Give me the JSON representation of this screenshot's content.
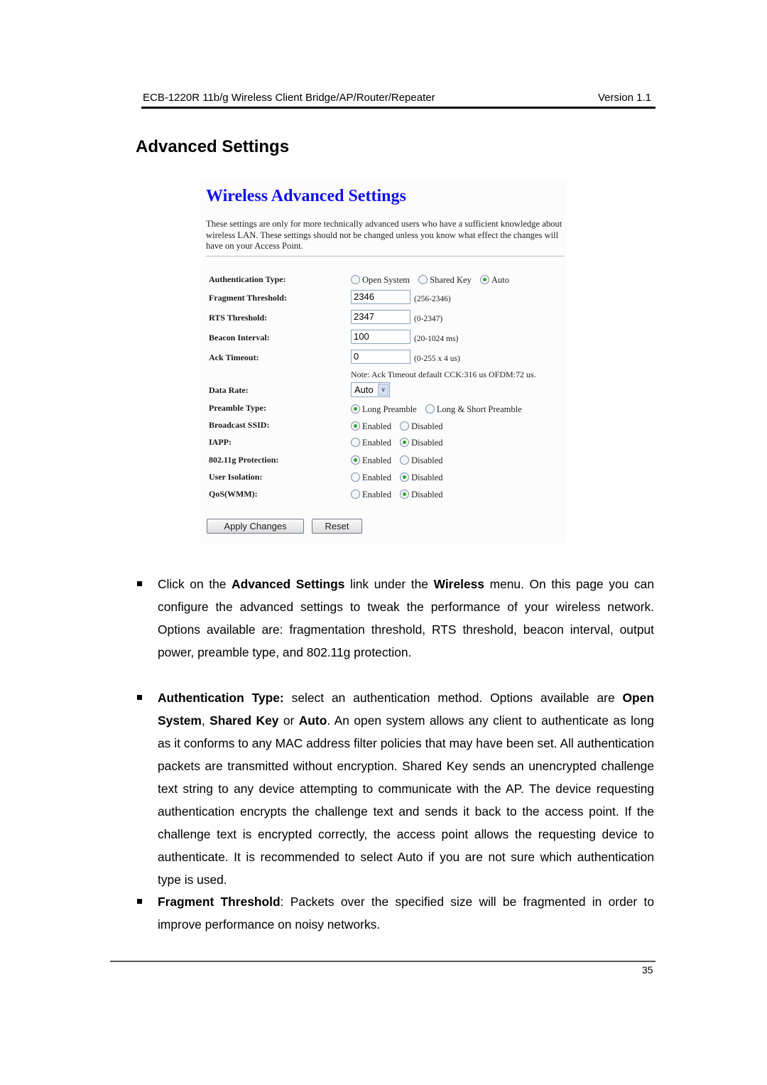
{
  "header": {
    "product": "ECB-1220R 11b/g Wireless Client Bridge/AP/Router/Repeater",
    "version": "Version 1.1"
  },
  "section_title": "Advanced Settings",
  "screenshot": {
    "title": "Wireless Advanced Settings",
    "description": "These settings are only for more technically advanced users who have a sufficient knowledge about wireless LAN. These settings should not be changed unless you know what effect the changes will have on your Access Point.",
    "auth": {
      "label": "Authentication Type:",
      "options": [
        "Open System",
        "Shared Key",
        "Auto"
      ],
      "selected": "Auto"
    },
    "fragment": {
      "label": "Fragment Threshold:",
      "value": "2346",
      "hint": "(256-2346)"
    },
    "rts": {
      "label": "RTS Threshold:",
      "value": "2347",
      "hint": "(0-2347)"
    },
    "beacon": {
      "label": "Beacon Interval:",
      "value": "100",
      "hint": "(20-1024 ms)"
    },
    "ack": {
      "label": "Ack Timeout:",
      "value": "0",
      "hint": "(0-255 x 4 us)"
    },
    "ack_note": "Note: Ack Timeout default CCK:316 us OFDM:72 us.",
    "data_rate": {
      "label": "Data Rate:",
      "value": "Auto"
    },
    "preamble": {
      "label": "Preamble Type:",
      "options": [
        "Long Preamble",
        "Long & Short Preamble"
      ],
      "selected": "Long Preamble"
    },
    "broadcast_ssid": {
      "label": "Broadcast SSID:",
      "options": [
        "Enabled",
        "Disabled"
      ],
      "selected": "Enabled"
    },
    "iapp": {
      "label": "IAPP:",
      "options": [
        "Enabled",
        "Disabled"
      ],
      "selected": "Disabled"
    },
    "protection": {
      "label": "802.11g Protection:",
      "options": [
        "Enabled",
        "Disabled"
      ],
      "selected": "Enabled"
    },
    "isolation": {
      "label": "User Isolation:",
      "options": [
        "Enabled",
        "Disabled"
      ],
      "selected": "Disabled"
    },
    "qos": {
      "label": "QoS(WMM):",
      "options": [
        "Enabled",
        "Disabled"
      ],
      "selected": "Disabled"
    },
    "apply_label": "Apply Changes",
    "reset_label": "Reset"
  },
  "body": {
    "p1": {
      "t1": "Click on the ",
      "b1": "Advanced Settings",
      "t2": " link under the ",
      "b2": "Wireless",
      "t3": " menu. On this page you can configure the advanced settings to tweak the performance of your wireless network. Options available are: fragmentation threshold, RTS threshold, beacon interval, output power, preamble type, and 802.11g protection."
    },
    "p2": {
      "b1": "Authentication Type:",
      "t1": " select an authentication method. Options available are ",
      "b2": "Open System",
      "t2": ", ",
      "b3": "Shared Key",
      "t3": " or ",
      "b4": "Auto",
      "t4": ". An open system allows any client to authenticate as long as it conforms to any MAC address filter policies that may have been set. All authentication packets are transmitted without encryption. Shared Key sends an unencrypted challenge text string to any device attempting to communicate with the AP. The device requesting authentication encrypts the challenge text and sends it back to the access point. If the challenge text is encrypted correctly, the access point allows the requesting device to authenticate. It is recommended to select Auto if you are not sure which authentication type is used."
    },
    "p3": {
      "b1": "Fragment Threshold",
      "t1": ": Packets over the specified size will be fragmented in order to improve performance on noisy networks."
    }
  },
  "footer": {
    "page_number": "35"
  }
}
